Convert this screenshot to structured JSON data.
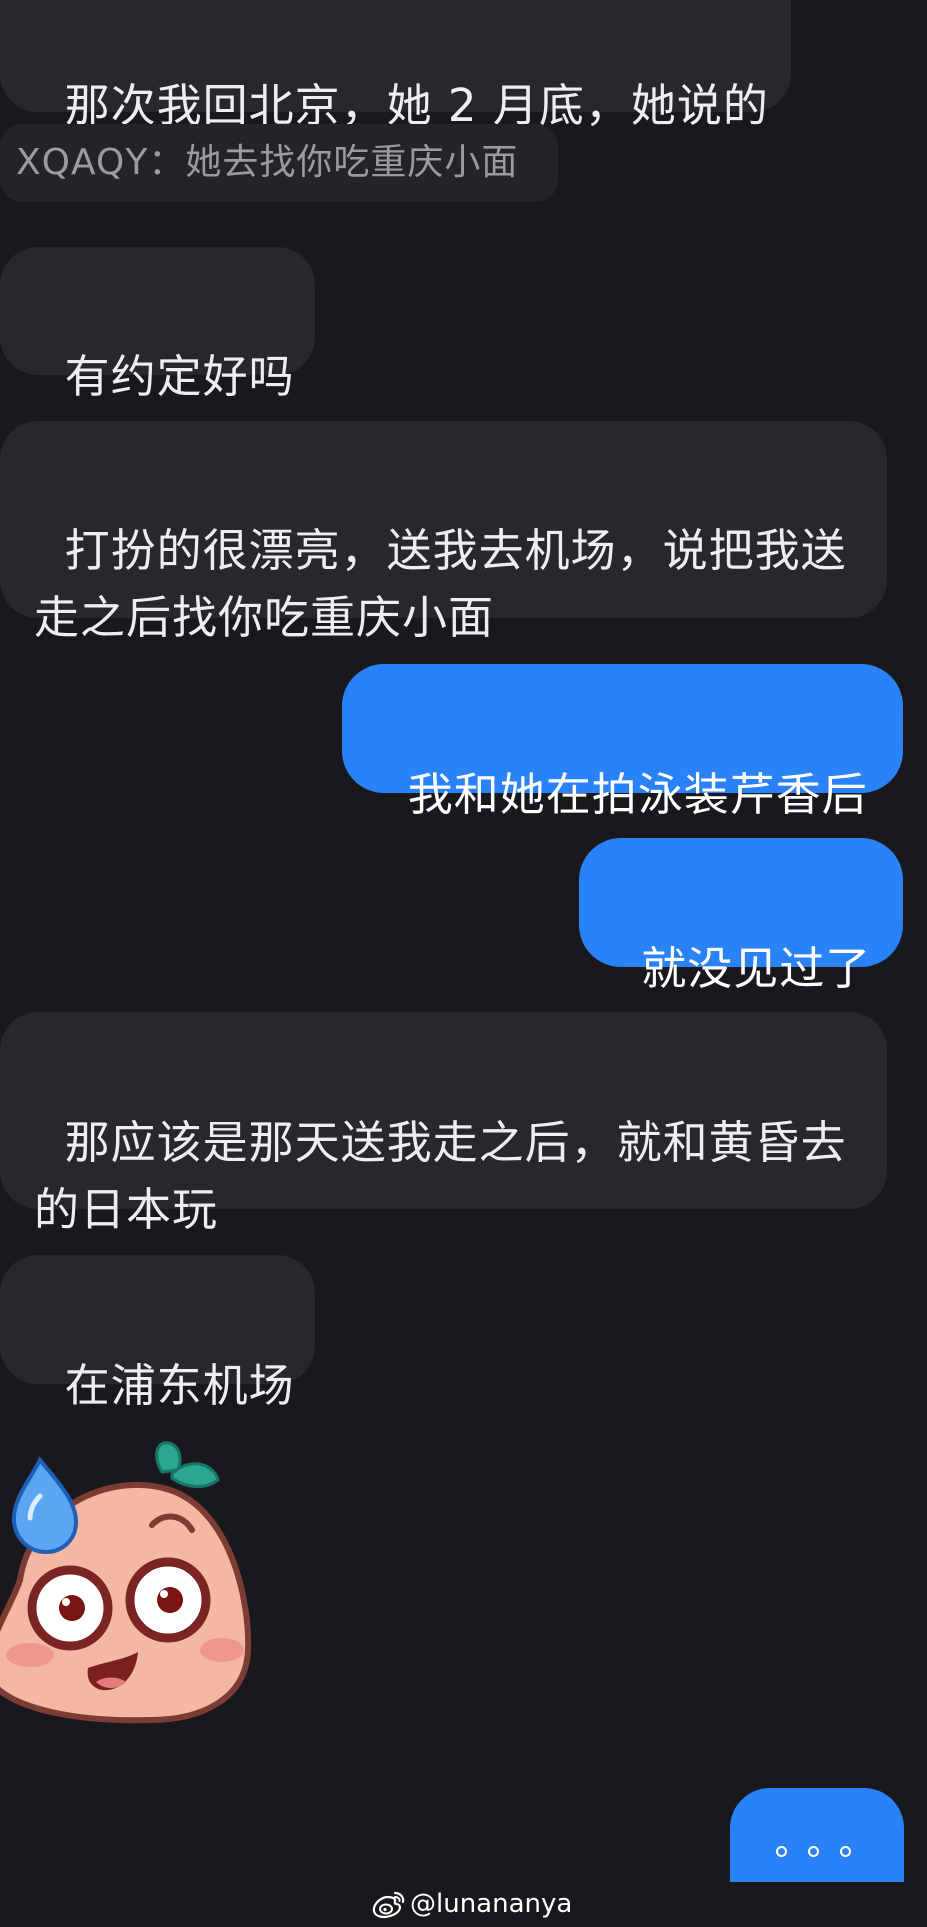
{
  "messages": {
    "m1": "那次我回北京，她 2 月底，她说的",
    "quote": "XQAQY：她去找你吃重庆小面",
    "m2": "有约定好吗",
    "m3": "打扮的很漂亮，送我去机场，说把我送\n走之后找你吃重庆小面",
    "m4": "我和她在拍泳装芹香后",
    "m5": "就没见过了",
    "m6": "那应该是那天送我走之后，就和黄昏去\n的日本玩",
    "m7": "在浦东机场"
  },
  "sticker": {
    "icon": "sweating-peach-emoji-icon"
  },
  "typing_indicator": {
    "icon": "typing-dots-icon"
  },
  "watermark": {
    "handle": "@lunananya",
    "icon": "weibo-logo-icon"
  },
  "colors": {
    "background": "#19191d",
    "incoming_bubble": "#27272c",
    "outgoing_bubble": "#2a82f8",
    "quote_text": "#9a9aa0"
  }
}
